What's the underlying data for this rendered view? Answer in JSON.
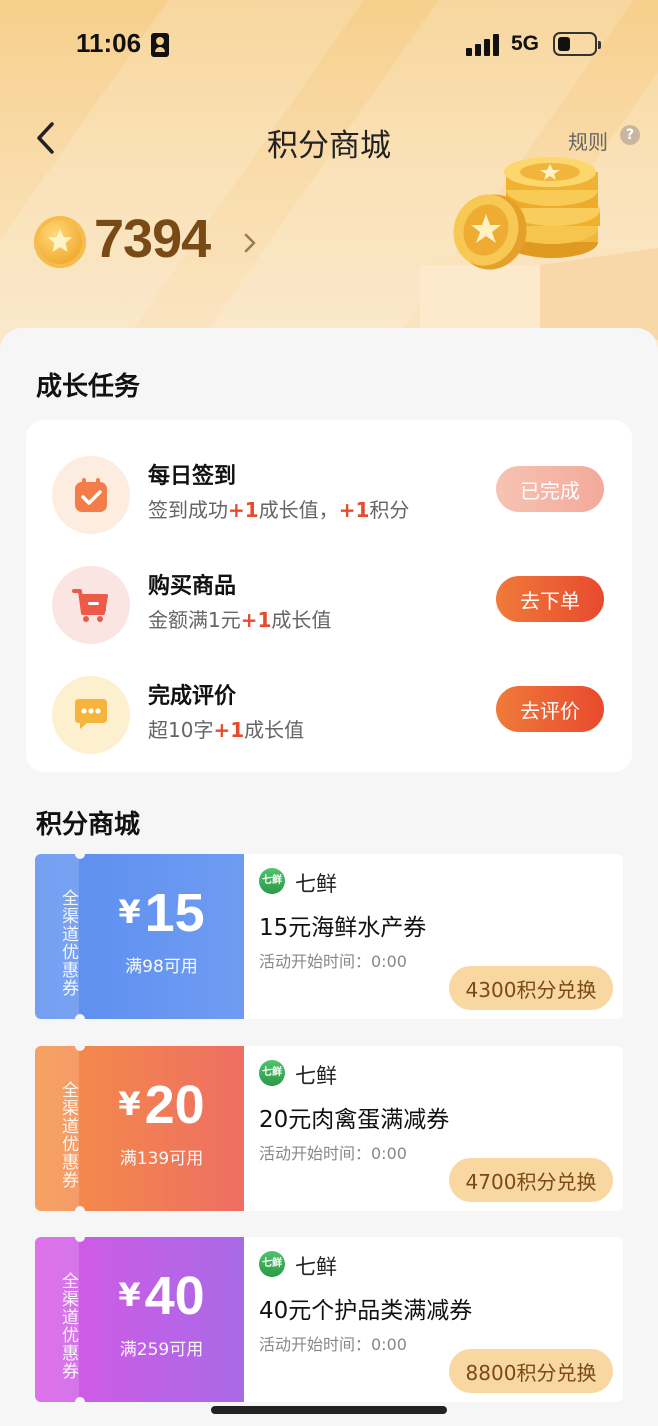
{
  "status_bar": {
    "time": "11:06",
    "network": "5G"
  },
  "header": {
    "title": "积分商城",
    "rules": "规则",
    "help": "?"
  },
  "points": {
    "value": "7394"
  },
  "tasks": {
    "section_title": "成长任务",
    "items": [
      {
        "name": "每日签到",
        "desc": [
          "签到成功",
          "+1",
          "成长值，",
          "+1",
          "积分"
        ],
        "button": "已完成",
        "icon": "calendar-check-icon"
      },
      {
        "name": "购买商品",
        "desc": [
          "金额满1元",
          "+1",
          "成长值"
        ],
        "button": "去下单",
        "icon": "cart-icon"
      },
      {
        "name": "完成评价",
        "desc": [
          "超10字",
          "+1",
          "成长值"
        ],
        "button": "去评价",
        "icon": "chat-bubble-icon"
      }
    ]
  },
  "mall": {
    "section_title": "积分商城",
    "coupons": [
      {
        "tag": [
          "全",
          "渠",
          "道",
          "优",
          "惠",
          "券"
        ],
        "yen": "¥",
        "amount": "15",
        "condition": "满98可用",
        "shop_logo": "七鲜",
        "shop": "七鲜",
        "title": "15元海鲜水产券",
        "time": "活动开始时间：0:00",
        "redeem": "4300积分兑换",
        "color_from": "#5b8df0",
        "color_to": "#6f9cf2"
      },
      {
        "tag": [
          "全",
          "渠",
          "道",
          "优",
          "惠",
          "券"
        ],
        "yen": "¥",
        "amount": "20",
        "condition": "满139可用",
        "shop_logo": "七鲜",
        "shop": "七鲜",
        "title": "20元肉禽蛋满减券",
        "time": "活动开始时间：0:00",
        "redeem": "4700积分兑换",
        "color_from": "#f59046",
        "color_to": "#ee6e62"
      },
      {
        "tag": [
          "全",
          "渠",
          "道",
          "优",
          "惠",
          "券"
        ],
        "yen": "¥",
        "amount": "40",
        "condition": "满259可用",
        "shop_logo": "七鲜",
        "shop": "七鲜",
        "title": "40元个护品类满减券",
        "time": "活动开始时间：0:00",
        "redeem": "8800积分兑换",
        "color_from": "#d857e6",
        "color_to": "#a86ae6"
      }
    ]
  },
  "colors": {
    "accent": "#e84a2e",
    "points_text": "#7a4a16",
    "hero": "#f7cf8c"
  }
}
